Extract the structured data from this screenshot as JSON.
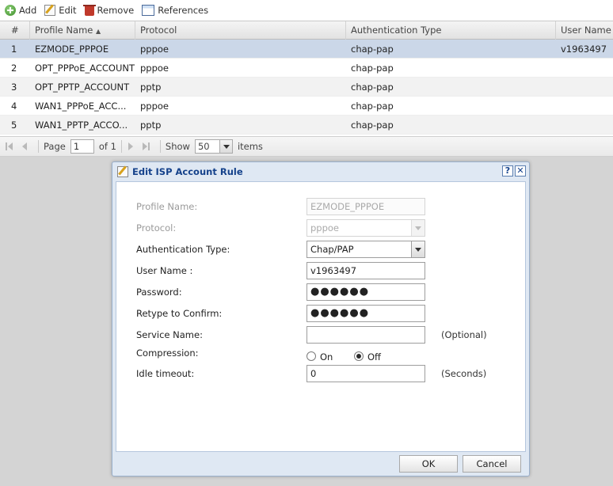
{
  "toolbar": {
    "add": "Add",
    "edit": "Edit",
    "remove": "Remove",
    "references": "References"
  },
  "grid": {
    "columns": [
      "#",
      "Profile Name",
      "Protocol",
      "Authentication Type",
      "User Name"
    ],
    "sort_indicator": "▲",
    "rows": [
      {
        "num": "1",
        "profile": "EZMODE_PPPOE",
        "protocol": "pppoe",
        "auth": "chap-pap",
        "user": "v1963497"
      },
      {
        "num": "2",
        "profile": "OPT_PPPoE_ACCOUNT",
        "protocol": "pppoe",
        "auth": "chap-pap",
        "user": ""
      },
      {
        "num": "3",
        "profile": "OPT_PPTP_ACCOUNT",
        "protocol": "pptp",
        "auth": "chap-pap",
        "user": ""
      },
      {
        "num": "4",
        "profile": "WAN1_PPPoE_ACC...",
        "protocol": "pppoe",
        "auth": "chap-pap",
        "user": ""
      },
      {
        "num": "5",
        "profile": "WAN1_PPTP_ACCO...",
        "protocol": "pptp",
        "auth": "chap-pap",
        "user": ""
      }
    ],
    "selected_row": 1
  },
  "pager": {
    "page_label": "Page",
    "page_value": "1",
    "of_label": "of 1",
    "show_label": "Show",
    "page_size": "50",
    "items_label": "items"
  },
  "dialog": {
    "title": "Edit ISP Account Rule",
    "help": "?",
    "close": "✕",
    "fields": {
      "profile_name_label": "Profile Name:",
      "profile_name_value": "EZMODE_PPPOE",
      "protocol_label": "Protocol:",
      "protocol_value": "pppoe",
      "auth_type_label": "Authentication Type:",
      "auth_type_value": "Chap/PAP",
      "user_name_label": "User Name :",
      "user_name_value": "v1963497",
      "password_label": "Password:",
      "password_value": "●●●●●●",
      "retype_label": "Retype to Confirm:",
      "retype_value": "●●●●●●",
      "service_name_label": "Service Name:",
      "service_name_value": "",
      "service_name_hint": "(Optional)",
      "compression_label": "Compression:",
      "compression_on": "On",
      "compression_off": "Off",
      "compression_selected": "Off",
      "idle_timeout_label": "Idle timeout:",
      "idle_timeout_value": "0",
      "idle_timeout_hint": "(Seconds)"
    },
    "ok": "OK",
    "cancel": "Cancel"
  }
}
